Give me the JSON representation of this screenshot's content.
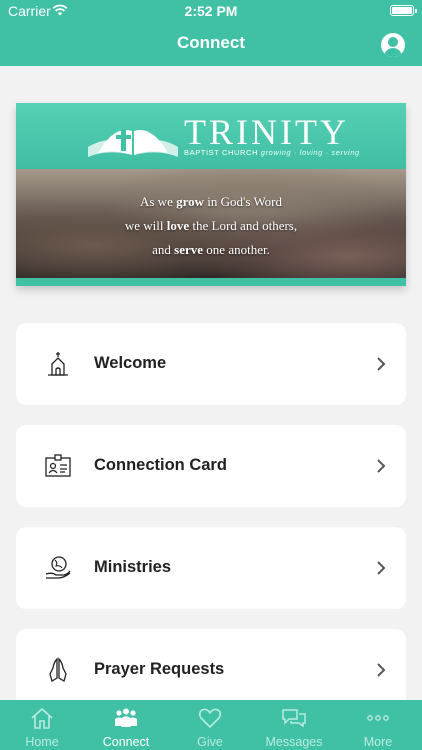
{
  "status_bar": {
    "carrier": "Carrier",
    "time": "2:52 PM"
  },
  "header": {
    "title": "Connect"
  },
  "banner": {
    "brand_name": "TRINITY",
    "brand_sub": "BAPTIST CHURCH",
    "brand_tagline": "growing · loving · serving",
    "verse_line1_a": "As we ",
    "verse_line1_b": "grow",
    "verse_line1_c": " in God's Word",
    "verse_line2_a": "we will ",
    "verse_line2_b": "love",
    "verse_line2_c": " the Lord and others,",
    "verse_line3_a": "and ",
    "verse_line3_b": "serve",
    "verse_line3_c": " one another."
  },
  "menu": {
    "items": [
      {
        "label": "Welcome",
        "icon": "church-icon"
      },
      {
        "label": "Connection Card",
        "icon": "id-card-icon"
      },
      {
        "label": "Ministries",
        "icon": "globe-hand-icon"
      },
      {
        "label": "Prayer Requests",
        "icon": "praying-hands-icon"
      }
    ]
  },
  "tabbar": {
    "tabs": [
      {
        "label": "Home",
        "icon": "home-icon"
      },
      {
        "label": "Connect",
        "icon": "people-icon",
        "active": true
      },
      {
        "label": "Give",
        "icon": "heart-icon"
      },
      {
        "label": "Messages",
        "icon": "messages-icon"
      },
      {
        "label": "More",
        "icon": "more-icon"
      }
    ]
  },
  "colors": {
    "accent": "#40c1a6",
    "card_bg": "#ffffff",
    "page_bg": "#f2f2f2",
    "text_dark": "#222222"
  }
}
